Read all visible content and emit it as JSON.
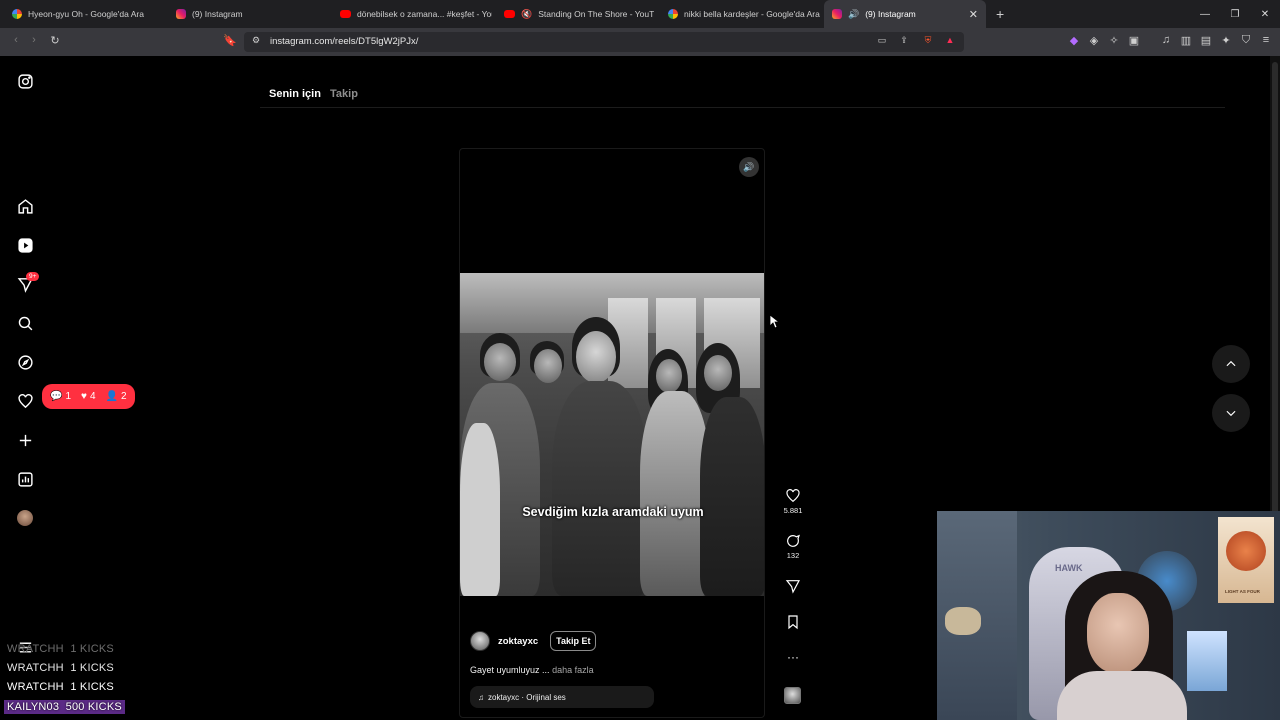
{
  "browser": {
    "tabs": [
      {
        "title": "Hyeon-gyu Oh - Google'da Ara",
        "icon": "google-icon"
      },
      {
        "title": "(9) Instagram",
        "icon": "instagram-icon"
      },
      {
        "title": "dönebilsek o zamana... #keşfet - You",
        "icon": "youtube-icon"
      },
      {
        "title": "Standing On The Shore - YouTube",
        "icon": "youtube-icon"
      },
      {
        "title": "nikki bella kardeşler - Google'da Ara",
        "icon": "google-icon"
      },
      {
        "title": "(9) Instagram",
        "icon": "instagram-icon",
        "active": true
      }
    ],
    "url": "instagram.com/reels/DT5lgW2jPJx/"
  },
  "sidebar": {
    "notification_badge": "9+",
    "activity": {
      "comments": "1",
      "likes": "4",
      "follows": "2"
    }
  },
  "feed_tabs": {
    "for_you": "Senin için",
    "following": "Takip"
  },
  "reel": {
    "overlay_text": "Sevdiğim kızla aramdaki uyum",
    "author": "zoktayxc",
    "follow_label": "Takip Et",
    "caption": "Gayet uyumluyuz ...",
    "more_label": "daha fazla",
    "audio": "zoktayxc · Orijinal ses",
    "likes": "5.881",
    "comments": "132"
  },
  "webcam": {
    "chair_label": "HAWK",
    "poster_text": "LIGHT AS FOUR"
  },
  "kick_chat": [
    {
      "user": "WRATCHH",
      "amount": "1 KICKS"
    },
    {
      "user": "WRATCHH",
      "amount": "1 KICKS"
    },
    {
      "user": "WRATCHH",
      "amount": "1 KICKS"
    },
    {
      "user": "KAILYN03",
      "amount": "500 KICKS"
    }
  ],
  "colors": {
    "accent_red": "#ff3040",
    "kick_purple": "#5b2a86"
  }
}
